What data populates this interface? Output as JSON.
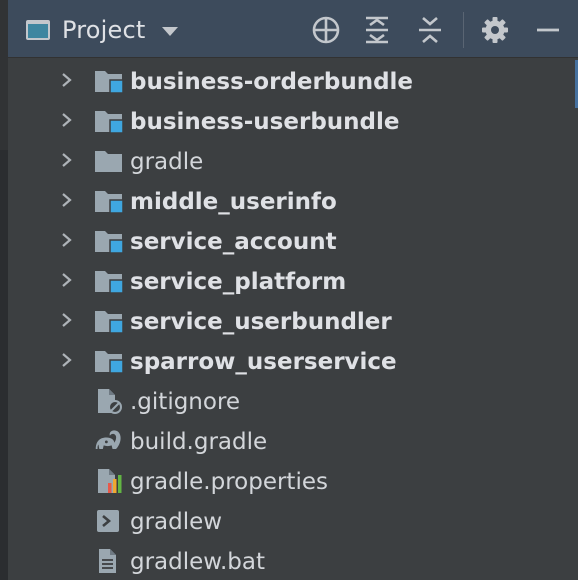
{
  "header": {
    "title": "Project",
    "tools": [
      {
        "name": "select-opened-file-icon"
      },
      {
        "name": "expand-all-icon"
      },
      {
        "name": "collapse-all-icon"
      },
      {
        "name": "gear-icon"
      },
      {
        "name": "minimize-icon"
      }
    ]
  },
  "tree": {
    "items": [
      {
        "label": "business-orderbundle",
        "type": "module",
        "bold": true,
        "expandable": true
      },
      {
        "label": "business-userbundle",
        "type": "module",
        "bold": true,
        "expandable": true
      },
      {
        "label": "gradle",
        "type": "folder",
        "bold": false,
        "expandable": true
      },
      {
        "label": "middle_userinfo",
        "type": "module",
        "bold": true,
        "expandable": true
      },
      {
        "label": "service_account",
        "type": "module",
        "bold": true,
        "expandable": true
      },
      {
        "label": "service_platform",
        "type": "module",
        "bold": true,
        "expandable": true
      },
      {
        "label": "service_userbundler",
        "type": "module",
        "bold": true,
        "expandable": true
      },
      {
        "label": "sparrow_userservice",
        "type": "module",
        "bold": true,
        "expandable": true
      },
      {
        "label": ".gitignore",
        "type": "ignore-file",
        "bold": false,
        "expandable": false
      },
      {
        "label": "build.gradle",
        "type": "gradle-file",
        "bold": false,
        "expandable": false
      },
      {
        "label": "gradle.properties",
        "type": "properties-file",
        "bold": false,
        "expandable": false
      },
      {
        "label": "gradlew",
        "type": "shell-file",
        "bold": false,
        "expandable": false
      },
      {
        "label": "gradlew.bat",
        "type": "text-file",
        "bold": false,
        "expandable": false
      }
    ]
  },
  "colors": {
    "header_bg": "#3d4b5c",
    "panel_bg": "#3c3f41",
    "module_badge": "#3fa7e0",
    "folder": "#9aa7b0",
    "text": "#dfe1e5"
  }
}
